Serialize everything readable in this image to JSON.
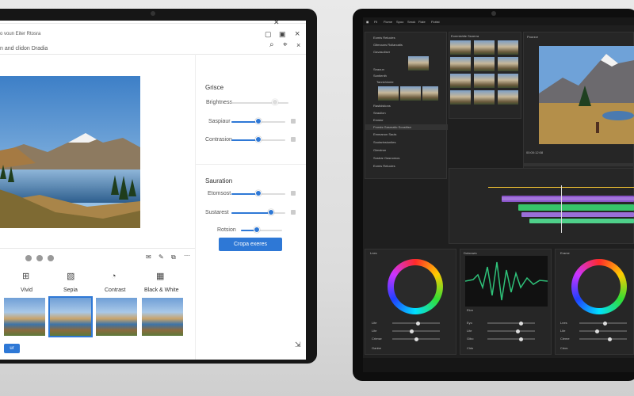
{
  "left_app": {
    "window_title": "o voun Eiter Rtosra",
    "subtitle": "n and clidon Dradia",
    "panel1": {
      "title": "Grisce",
      "rows": [
        {
          "label": "Brightness",
          "value": 0.8
        },
        {
          "label": "Saspiaur",
          "value": 0.5
        },
        {
          "label": "Contrasion",
          "value": 0.5
        }
      ]
    },
    "panel2": {
      "title": "Sauration",
      "rows": [
        {
          "label": "Etomsost",
          "value": 0.5
        },
        {
          "label": "Sustarest",
          "value": 0.72
        },
        {
          "label": "Rotsion",
          "value": 0.4
        }
      ]
    },
    "apply_button": "Cropa exeres",
    "small_button": "ur",
    "filters": [
      {
        "label": "Vivid",
        "icon": "grid-icon"
      },
      {
        "label": "Sepia",
        "icon": "image-icon"
      },
      {
        "label": "Contrast",
        "icon": "contrast-icon"
      },
      {
        "label": "Black & White",
        "icon": "bw-icon"
      }
    ]
  },
  "right_app": {
    "menu": [
      "Fil",
      "Fiome",
      "Spoo",
      "Smok",
      "Fiale",
      "Fiotist"
    ],
    "project_panel_title": "Eomis Relucies",
    "media_panel_title": "Eorenishite Ssnerra",
    "preview_title": "Pourzor",
    "layers": [
      "Eomis Relucies",
      "Gitmouns Rollarcatis",
      "Gavasoliser",
      "Seaoun",
      "Sontienth",
      "Tanrichinnte",
      "Rastidstions",
      "Seaulion",
      "Emstor",
      "Frorsts Gasmatic Sousitisn",
      "Emmanon Sauls",
      "Sootarinsionites",
      "Gimstron",
      "Sostrar Gasnomos"
    ],
    "timecode": "00:00:12:08",
    "color_panels": [
      {
        "title": "Lnes",
        "rows": [
          "Lite",
          "Lite",
          "Crimse",
          "Ganbe"
        ]
      },
      {
        "title": "Dolouwrs",
        "rows": [
          "Eyo",
          "Lite",
          "Gibo",
          "Cldo"
        ]
      },
      {
        "title": "Erame",
        "rows": [
          "Lnes",
          "Lite",
          "Cleme",
          "Cdos"
        ]
      }
    ],
    "wave_label": "Elon",
    "track_colors": [
      "#8a55c9",
      "#b48ae8",
      "#37c36a",
      "#9a6fd8",
      "#4fd08a"
    ]
  }
}
